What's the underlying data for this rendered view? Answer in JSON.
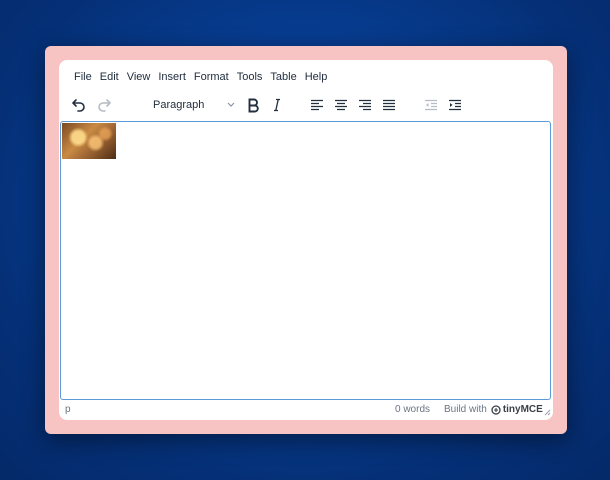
{
  "menubar": {
    "items": [
      {
        "label": "File"
      },
      {
        "label": "Edit"
      },
      {
        "label": "View"
      },
      {
        "label": "Insert"
      },
      {
        "label": "Format"
      },
      {
        "label": "Tools"
      },
      {
        "label": "Table"
      },
      {
        "label": "Help"
      }
    ]
  },
  "toolbar": {
    "block_format": "Paragraph",
    "buttons": [
      "undo-icon",
      "redo-icon",
      "bold-icon",
      "italic-icon",
      "align-left-icon",
      "align-center-icon",
      "align-right-icon",
      "align-justify-icon",
      "outdent-icon",
      "indent-icon"
    ]
  },
  "statusbar": {
    "path": "p",
    "word_count": "0 words",
    "branding_prefix": "Build with",
    "branding_name": "tinyMCE"
  },
  "colors": {
    "frame": "#f7c3c3",
    "accent_border": "#5a9ad8",
    "background": "#073d92",
    "text": "#222f3e"
  }
}
